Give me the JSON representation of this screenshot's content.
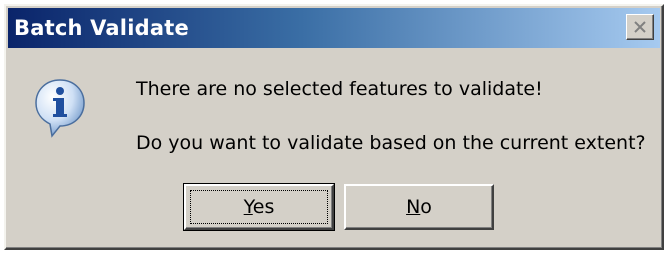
{
  "window": {
    "title": "Batch Validate",
    "close_glyph": "✕"
  },
  "message": {
    "icon": "info-icon",
    "line1": "There are no selected features to validate!",
    "line2": "Do you want to validate based on the current extent?"
  },
  "buttons": {
    "yes_label": "Yes",
    "yes_mnemonic": "Y",
    "yes_rest": "es",
    "no_label": "No",
    "no_mnemonic": "N",
    "no_rest": "o"
  },
  "colors": {
    "title_start": "#0a246a",
    "title_end": "#a6caf0",
    "face": "#d4d0c8"
  }
}
